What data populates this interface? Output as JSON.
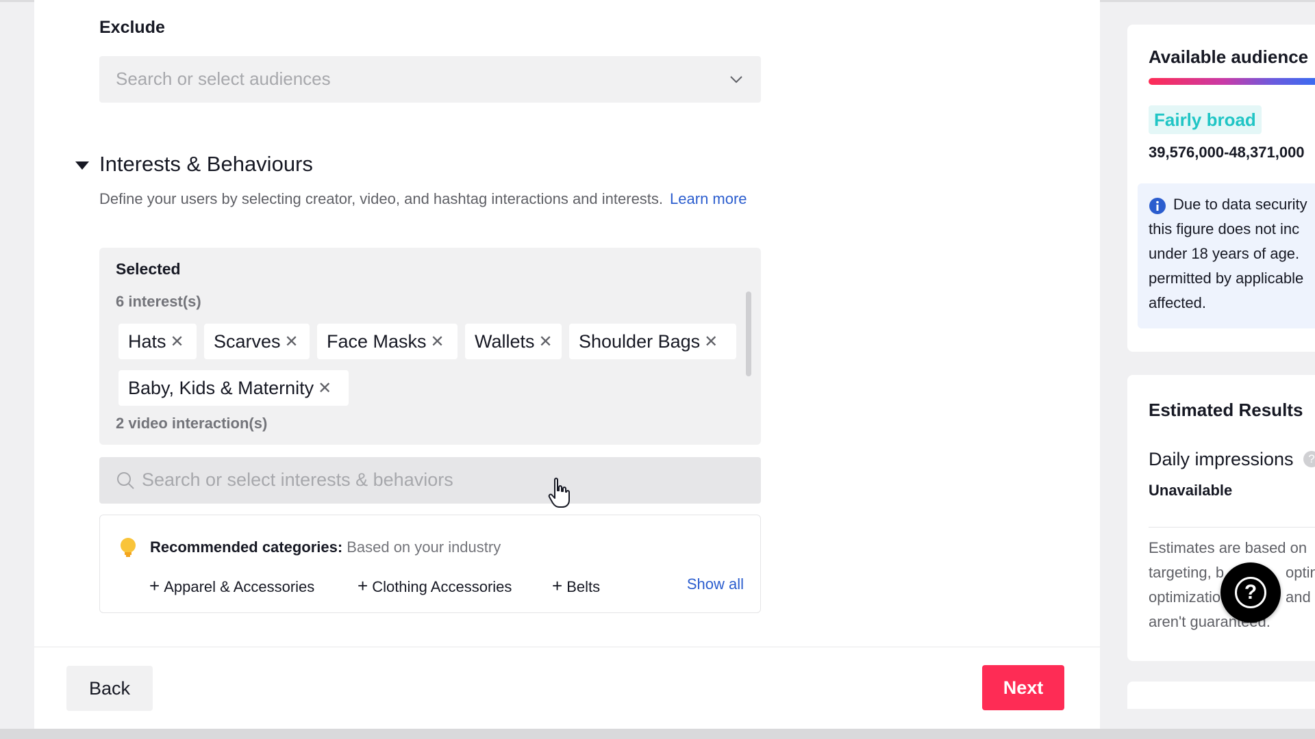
{
  "exclude": {
    "label": "Exclude",
    "placeholder": "Search or select audiences"
  },
  "interests": {
    "title": "Interests & Behaviours",
    "description": "Define your users by selecting creator, video, and hashtag interactions and interests.",
    "learn_more": "Learn more",
    "selected": {
      "title": "Selected",
      "interest_count": "6 interest(s)",
      "chips": [
        "Hats",
        "Scarves",
        "Face Masks",
        "Wallets",
        "Shoulder Bags",
        "Baby, Kids & Maternity"
      ],
      "video_count": "2 video interaction(s)"
    },
    "search_placeholder": "Search or select interests & behaviors",
    "recommended": {
      "title": "Recommended categories:",
      "subtitle": "Based on your industry",
      "items": [
        "Apparel & Accessories",
        "Clothing Accessories",
        "Belts"
      ],
      "show_all": "Show all"
    }
  },
  "footer": {
    "back": "Back",
    "next": "Next"
  },
  "audience": {
    "title": "Available audience",
    "badge": "Fairly broad",
    "range": "39,576,000-48,371,000",
    "info_lines": [
      "Due to data security",
      "this figure does not inc",
      "under 18 years of age.",
      "permitted by applicable",
      "affected."
    ]
  },
  "estimated": {
    "title": "Estimated Results",
    "daily_label": "Daily impressions",
    "daily_value": "Unavailable",
    "note_lines": [
      "Estimates are based on",
      "targeting, b",
      "optimizatio",
      "aren't guaranteed."
    ],
    "note_lines_right": [
      "optin",
      "and i"
    ]
  },
  "colors": {
    "accent": "#fe2c55",
    "link": "#2b5dce",
    "badge_text": "#20c5c5"
  }
}
